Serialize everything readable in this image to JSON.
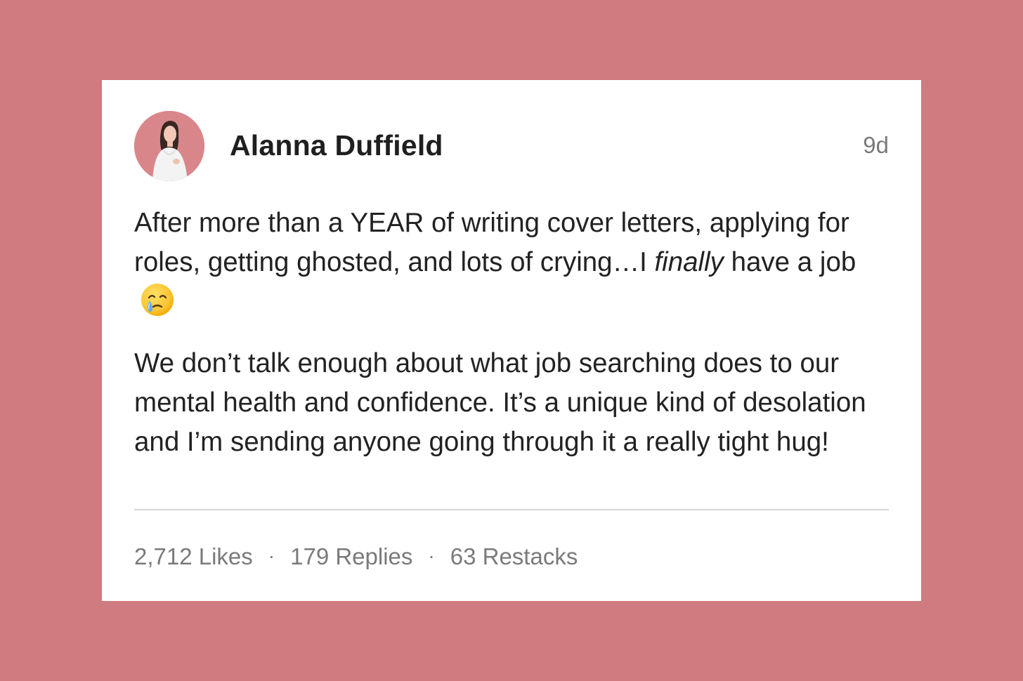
{
  "post": {
    "author_name": "Alanna Duffield",
    "age": "9d",
    "paragraph1": {
      "text_before": "After more than a YEAR of writing cover letters, applying for roles, getting ghosted, and lots of crying…I ",
      "emphasis": "finally",
      "text_after": " have a job",
      "emoji": "face-holding-back-tears-icon"
    },
    "paragraph2": "We don’t talk enough about what job searching does to our mental health and confidence. It’s a unique kind of desolation and I’m sending anyone going through it a really tight hug!",
    "stats": {
      "likes": "2,712 Likes",
      "separator": "·",
      "replies": "179 Replies",
      "restacks": "63 Restacks"
    }
  },
  "colors": {
    "background": "#cf7b80",
    "card": "#ffffff",
    "text": "#222222",
    "muted": "#7a7a7a",
    "divider": "#d6d6d6"
  }
}
